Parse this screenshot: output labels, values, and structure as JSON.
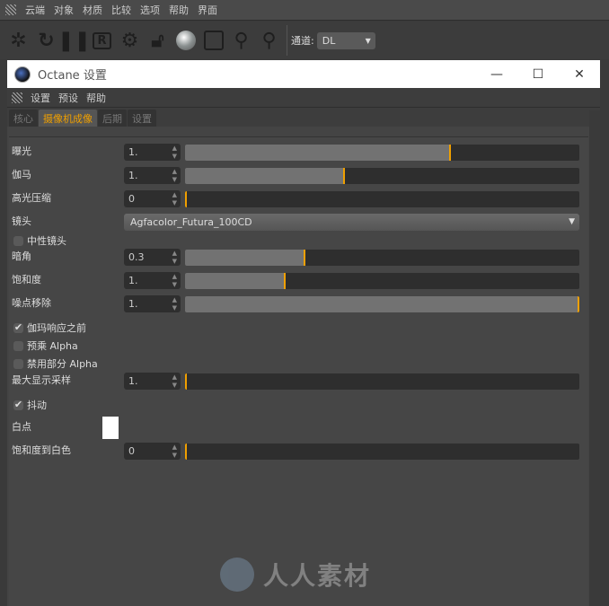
{
  "menubar": {
    "items": [
      "云端",
      "对象",
      "材质",
      "比较",
      "选项",
      "帮助",
      "界面"
    ]
  },
  "toolbar": {
    "icons": [
      "start-render-icon",
      "restart-icon",
      "pause-icon",
      "r-icon",
      "gear-icon",
      "unlock-icon",
      "material-sphere-icon",
      "region-icon",
      "f-pin-icon",
      "m-pin-icon"
    ],
    "channel_label": "通道:",
    "channel_value": "DL"
  },
  "window": {
    "title": "Octane 设置",
    "minimize": "—",
    "maximize": "☐",
    "close": "✕"
  },
  "dialog_menu": [
    "设置",
    "预设",
    "帮助"
  ],
  "tabs": [
    {
      "label": "核心"
    },
    {
      "label": "摄像机成像",
      "active": true
    },
    {
      "label": "后期"
    },
    {
      "label": "设置"
    }
  ],
  "accent": "#f0a000",
  "settings": {
    "exposure": {
      "label": "曝光",
      "value": "1.",
      "fill": 0.67
    },
    "gamma": {
      "label": "伽马",
      "value": "1.",
      "fill": 0.4
    },
    "highlight": {
      "label": "高光压缩",
      "value": "0",
      "fill": 0
    },
    "lens": {
      "label": "镜头",
      "value": "Agfacolor_Futura_100CD"
    },
    "neutral": {
      "label": "中性镜头",
      "checked": false
    },
    "vignetting": {
      "label": "暗角",
      "value": "0.3",
      "fill": 0.3
    },
    "saturation": {
      "label": "饱和度",
      "value": "1.",
      "fill": 0.25
    },
    "denoise": {
      "label": "噪点移除",
      "value": "1.",
      "fill": 1.0
    },
    "gamma_before": {
      "label": "伽玛响应之前",
      "checked": true
    },
    "premultiply": {
      "label": "预乘 Alpha",
      "checked": false
    },
    "disable_partial": {
      "label": "禁用部分 Alpha",
      "checked": false
    },
    "max_samples": {
      "label": "最大显示采样",
      "value": "1.",
      "fill": 0
    },
    "dither": {
      "label": "抖动",
      "checked": true
    },
    "white_point": {
      "label": "白点",
      "color": "#ffffff"
    },
    "sat_to_white": {
      "label": "饱和度到白色",
      "value": "0",
      "fill": 0
    }
  },
  "watermark": "人人素材"
}
